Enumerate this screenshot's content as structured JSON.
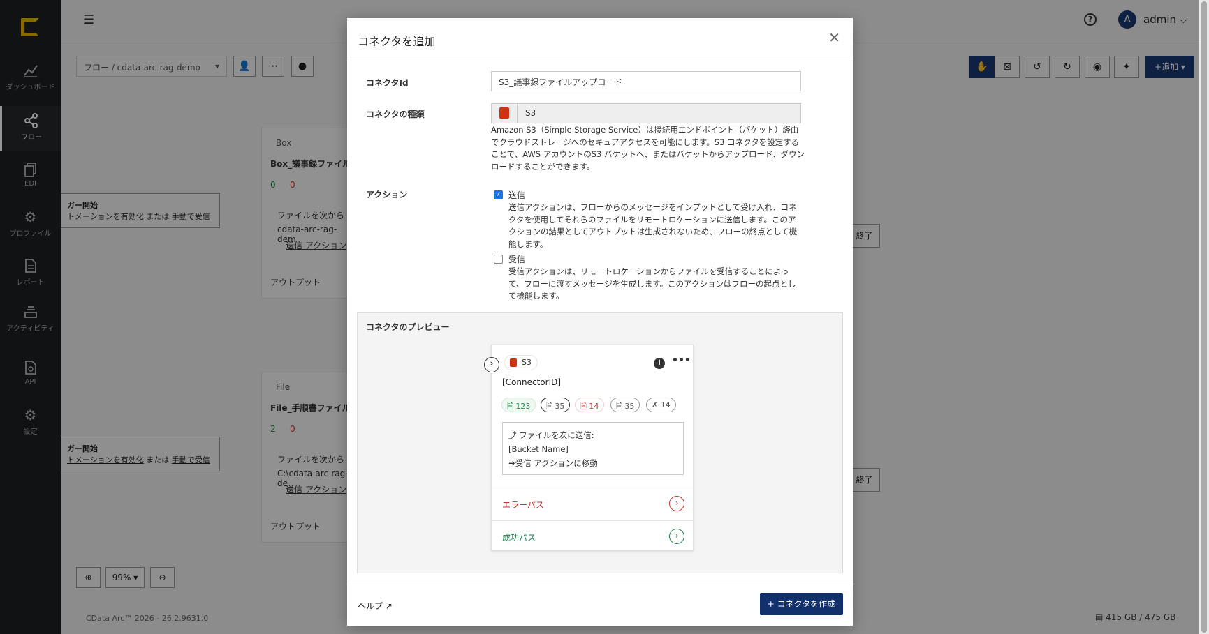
{
  "sidebar": {
    "items": [
      {
        "label": "ダッシュボード",
        "icon": "chart-line-icon"
      },
      {
        "label": "フロー",
        "icon": "share-icon"
      },
      {
        "label": "EDI",
        "icon": "documents-icon"
      },
      {
        "label": "プロファイル",
        "icon": "gears-icon"
      },
      {
        "label": "レポート",
        "icon": "report-icon"
      },
      {
        "label": "アクティビティ",
        "icon": "layers-icon"
      },
      {
        "label": "API",
        "icon": "api-icon"
      },
      {
        "label": "設定",
        "icon": "gear-icon"
      }
    ]
  },
  "header": {
    "user": "admin",
    "avatar_letter": "A"
  },
  "canvas": {
    "breadcrumb": "フロー  /   cdata-arc-rag-demo",
    "add_label": "+追加 ▾",
    "zoom": "99% ▾",
    "version": "CData Arc™ 2026 - 26.2.9631.0",
    "storage": "415 GB / 475 GB",
    "card1": {
      "type": "Box",
      "name": "Box_議事録ファイル",
      "send_to": "ファイルを次から",
      "target": "cdata-arc-rag-dem",
      "link": "送信 アクション",
      "output": "アウトプット",
      "ok_count": "0",
      "err_count": "0"
    },
    "card2": {
      "type": "File",
      "name": "File_手順書ファイル",
      "send_to": "ファイルを次から",
      "target": "C:\\cdata-arc-rag-de",
      "link": "送信 アクション",
      "output": "アウトプット",
      "ok_count": "2",
      "err_count": "0"
    },
    "trigger": {
      "title": "ガー開始",
      "line_enable": "トメーションを有効化",
      "or": "または",
      "manual": "手動で受信"
    },
    "end_label": "終了"
  },
  "modal": {
    "title": "コネクタを追加",
    "connector_id_label": "コネクタId",
    "connector_id_value": "S3_議事録ファイルアップロード",
    "connector_type_label": "コネクタの種類",
    "connector_type_value": "S3",
    "type_description": "Amazon S3（Simple Storage Service）は接続用エンドポイント（バケット）経由でクラウドストレージへのセキュアアクセスを可能にします。S3 コネクタを設定することで、AWS アカウントのS3 バケットへ、またはバケットからアップロード、ダウンロードすることができます。",
    "action_label": "アクション",
    "actions": [
      {
        "label": "送信",
        "checked": true,
        "desc": "送信アクションは、フローからのメッセージをインプットとして受け入れ、コネクタを使用してそれらのファイルをリモートロケーションに送信します。このアクションの結果としてアウトプットは生成されないため、フローの終点として機能します。"
      },
      {
        "label": "受信",
        "checked": false,
        "desc": "受信アクションは、リモートロケーションからファイルを受信することによって、フローに渡すメッセージを生成します。このアクションはフローの起点として機能します。"
      }
    ],
    "preview": {
      "title": "コネクタのプレビュー",
      "tag": "S3",
      "connector_id": "[ConnectorID]",
      "stats": [
        "123",
        "35",
        "14",
        "35",
        "14"
      ],
      "send_to": "ファイルを次に送信:",
      "bucket": "[Bucket Name]",
      "move_link": "受信 アクションに移動",
      "error_path": "エラーパス",
      "success_path": "成功パス"
    },
    "help": "ヘルプ",
    "create": "+ コネクタを作成"
  },
  "colors": {
    "primary": "#12306b",
    "sidebar_bg": "#1e1f22",
    "error": "#c0392b",
    "success": "#1e8a4c",
    "s3": "#d13212"
  }
}
